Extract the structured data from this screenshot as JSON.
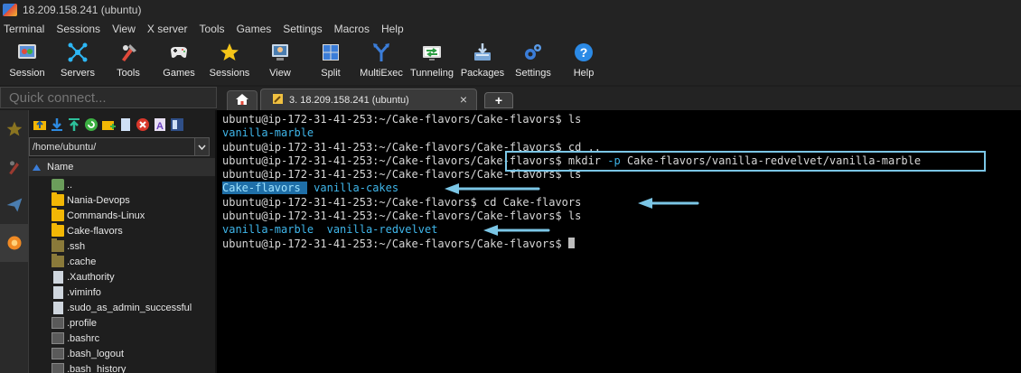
{
  "window": {
    "title": "18.209.158.241 (ubuntu)"
  },
  "menu": [
    "Terminal",
    "Sessions",
    "View",
    "X server",
    "Tools",
    "Games",
    "Settings",
    "Macros",
    "Help"
  ],
  "toolbar": [
    {
      "label": "Session",
      "icon": "session-icon"
    },
    {
      "label": "Servers",
      "icon": "servers-icon"
    },
    {
      "label": "Tools",
      "icon": "tools-icon"
    },
    {
      "label": "Games",
      "icon": "games-icon"
    },
    {
      "label": "Sessions",
      "icon": "star-icon"
    },
    {
      "label": "View",
      "icon": "view-icon"
    },
    {
      "label": "Split",
      "icon": "split-icon"
    },
    {
      "label": "MultiExec",
      "icon": "multiexec-icon"
    },
    {
      "label": "Tunneling",
      "icon": "tunneling-icon"
    },
    {
      "label": "Packages",
      "icon": "packages-icon"
    },
    {
      "label": "Settings",
      "icon": "settings-icon"
    },
    {
      "label": "Help",
      "icon": "help-icon"
    }
  ],
  "quick_connect": {
    "placeholder": "Quick connect..."
  },
  "tabs": {
    "session_label": "3. 18.209.158.241 (ubuntu)",
    "close": "×",
    "new": "+"
  },
  "file_browser": {
    "path": "/home/ubuntu/",
    "column_header": "Name",
    "items": [
      {
        "name": "..",
        "type": "up"
      },
      {
        "name": "Nania-Devops",
        "type": "folder"
      },
      {
        "name": "Commands-Linux",
        "type": "folder"
      },
      {
        "name": "Cake-flavors",
        "type": "folder"
      },
      {
        "name": ".ssh",
        "type": "folder-dark"
      },
      {
        "name": ".cache",
        "type": "folder-dark"
      },
      {
        "name": ".Xauthority",
        "type": "file"
      },
      {
        "name": ".viminfo",
        "type": "file"
      },
      {
        "name": ".sudo_as_admin_successful",
        "type": "file"
      },
      {
        "name": ".profile",
        "type": "term"
      },
      {
        "name": ".bashrc",
        "type": "term"
      },
      {
        "name": ".bash_logout",
        "type": "term"
      },
      {
        "name": ".bash_history",
        "type": "term"
      }
    ]
  },
  "terminal": {
    "line1": "ubuntu@ip-172-31-41-253:~/Cake-flavors/Cake-flavors$ ls",
    "line2": "vanilla-marble",
    "line3": "ubuntu@ip-172-31-41-253:~/Cake-flavors/Cake-flavors$ cd ..",
    "line4_prompt": "ubuntu@ip-172-31-41-253:~/Cake-flavors/Cake-flavors$ ",
    "line4_cmd": "mkdir",
    "line4_flag": "-p",
    "line4_arg": "Cake-flavors/vanilla-redvelvet/vanilla-marble",
    "line5": "ubuntu@ip-172-31-41-253:~/Cake-flavors/Cake-flavors$ ls",
    "line6_sel": "Cake-flavors",
    "line6_rest": "vanilla-cakes",
    "line7": "ubuntu@ip-172-31-41-253:~/Cake-flavors$ cd Cake-flavors",
    "line8": "ubuntu@ip-172-31-41-253:~/Cake-flavors/Cake-flavors$ ls",
    "line9": "vanilla-marble  vanilla-redvelvet",
    "line10": "ubuntu@ip-172-31-41-253:~/Cake-flavors/Cake-flavors$ "
  },
  "colors": {
    "terminal_bg": "#000000",
    "prompt": "#d7d7d7",
    "dir": "#3fb6ea",
    "annotation": "#7bc6e6"
  }
}
